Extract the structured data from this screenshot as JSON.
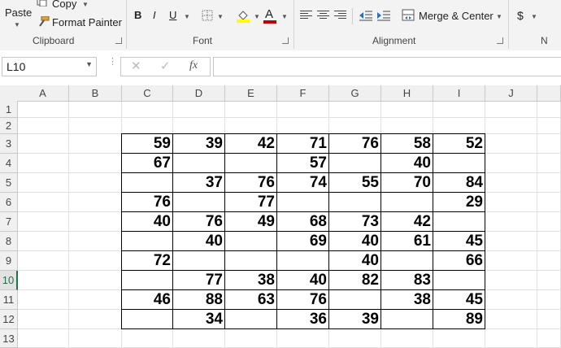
{
  "ribbon": {
    "clipboard": {
      "paste_label": "Paste",
      "copy_label": "Copy",
      "format_painter_label": "Format Painter",
      "group_label": "Clipboard"
    },
    "font": {
      "bold_label": "B",
      "italic_label": "I",
      "underline_label": "U",
      "font_color_label": "A",
      "group_label": "Font",
      "fill_color": "#ffff00",
      "font_color": "#c00000"
    },
    "alignment": {
      "merge_center_label": "Merge & Center",
      "group_label": "Alignment"
    },
    "number": {
      "currency_label": "$",
      "group_label_partial": "N"
    }
  },
  "formula_bar": {
    "name_box_value": "L10",
    "fx_label": "fx",
    "cancel_label": "✕",
    "enter_label": "✓",
    "formula_value": ""
  },
  "sheet": {
    "columns": [
      "A",
      "B",
      "C",
      "D",
      "E",
      "F",
      "G",
      "H",
      "I",
      "J"
    ],
    "rows": [
      "1",
      "2",
      "3",
      "4",
      "5",
      "6",
      "7",
      "8",
      "9",
      "10",
      "11",
      "12",
      "13"
    ],
    "active_row": "10",
    "table": [
      [
        "59",
        "39",
        "42",
        "71",
        "76",
        "58",
        "52"
      ],
      [
        "67",
        "",
        "",
        "57",
        "",
        "40",
        ""
      ],
      [
        "",
        "37",
        "76",
        "74",
        "55",
        "70",
        "84"
      ],
      [
        "76",
        "",
        "77",
        "",
        "",
        "",
        "29"
      ],
      [
        "40",
        "76",
        "49",
        "68",
        "73",
        "42",
        ""
      ],
      [
        "",
        "40",
        "",
        "69",
        "40",
        "61",
        "45"
      ],
      [
        "72",
        "",
        "",
        "",
        "40",
        "",
        "66"
      ],
      [
        "",
        "77",
        "38",
        "40",
        "82",
        "83",
        ""
      ],
      [
        "46",
        "88",
        "63",
        "76",
        "",
        "38",
        "45"
      ],
      [
        "",
        "34",
        "",
        "36",
        "39",
        "",
        "89"
      ]
    ]
  }
}
